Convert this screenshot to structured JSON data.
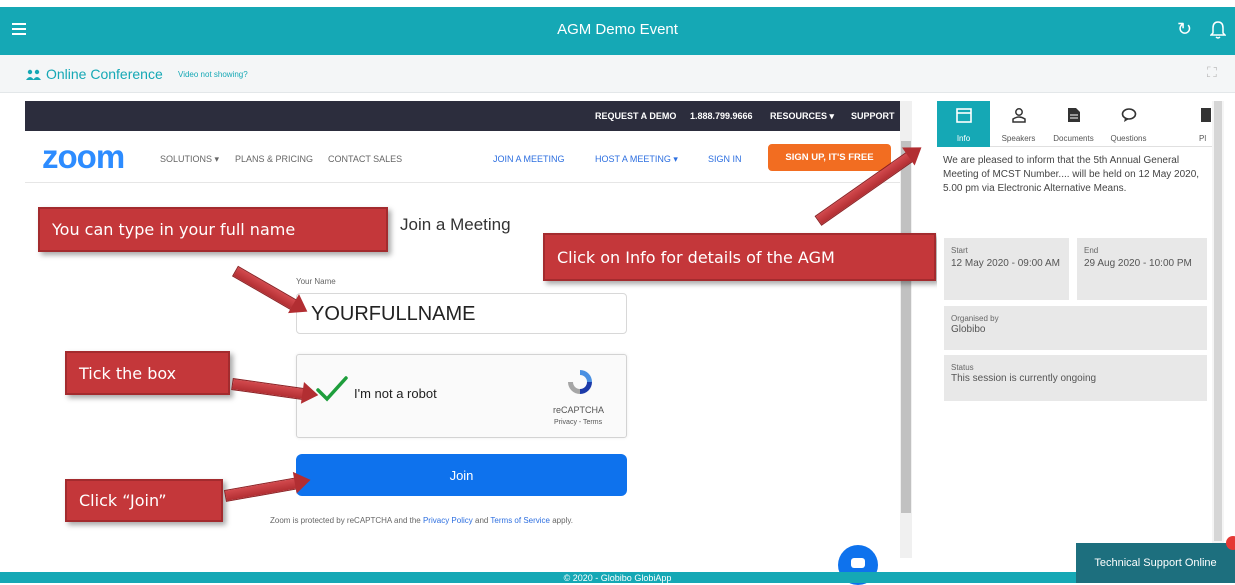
{
  "header": {
    "title": "AGM Demo Event"
  },
  "subbar": {
    "title": "Online Conference",
    "help_link": "Video not showing?"
  },
  "zoom": {
    "top_links": [
      "REQUEST A DEMO",
      "1.888.799.9666",
      "RESOURCES ▾",
      "SUPPORT"
    ],
    "logo": "zoom",
    "nav_left": [
      "SOLUTIONS ▾",
      "PLANS & PRICING",
      "CONTACT SALES"
    ],
    "nav_right": [
      "JOIN A MEETING",
      "HOST A MEETING ▾",
      "SIGN IN"
    ],
    "signup_label": "SIGN UP, IT'S FREE",
    "heading": "Join a Meeting",
    "name_label": "Your Name",
    "name_value": "YOURFULLNAME",
    "captcha_label": "I'm not a robot",
    "captcha_brand": "reCAPTCHA",
    "captcha_links": "Privacy - Terms",
    "join_label": "Join",
    "legal_prefix": "Zoom is protected by reCAPTCHA and the ",
    "legal_privacy": "Privacy Policy",
    "legal_and": " and ",
    "legal_terms": "Terms of Service",
    "legal_suffix": " apply."
  },
  "callouts": {
    "name": "You can type in your full name",
    "tick": "Tick the box",
    "join": "Click “Join”",
    "info": "Click on Info for details of the AGM"
  },
  "panel": {
    "tabs": [
      {
        "label": "Info",
        "icon": "calendar-icon"
      },
      {
        "label": "Speakers",
        "icon": "speaker-icon"
      },
      {
        "label": "Documents",
        "icon": "document-icon"
      },
      {
        "label": "Questions",
        "icon": "chat-icon"
      },
      {
        "label": "Pl",
        "icon": "poll-icon"
      }
    ],
    "description": "We are pleased to inform that the 5th Annual General Meeting of MCST Number.... will be held on 12 May 2020, 5.00 pm via Electronic Alternative Means.",
    "start_label": "Start",
    "start_value": "12 May 2020 - 09:00 AM",
    "end_label": "End",
    "end_value": "29 Aug 2020 - 10:00 PM",
    "organiser_label": "Organised by",
    "organiser_value": "Globibo",
    "status_label": "Status",
    "status_value": "This session is currently ongoing"
  },
  "footer": {
    "copyright": "© 2020 - Globibo GlobiApp"
  },
  "support": {
    "label": "Technical Support Online"
  },
  "colors": {
    "accent": "#15a8b5",
    "callout": "#c4373a",
    "zoom_blue": "#0e72ed",
    "signup_orange": "#f26d21"
  }
}
